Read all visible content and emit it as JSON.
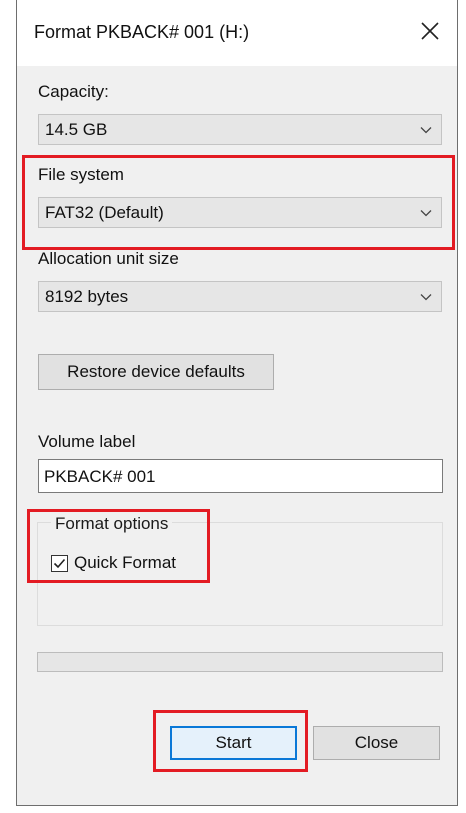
{
  "window": {
    "title": "Format PKBACK# 001 (H:)"
  },
  "capacity": {
    "label": "Capacity:",
    "value": "14.5 GB"
  },
  "file_system": {
    "label": "File system",
    "value": "FAT32 (Default)"
  },
  "allocation": {
    "label": "Allocation unit size",
    "value": "8192 bytes"
  },
  "restore_button": "Restore device defaults",
  "volume": {
    "label": "Volume label",
    "value": "PKBACK# 001"
  },
  "format_options": {
    "title": "Format options",
    "quick_format_label": "Quick Format",
    "quick_format_checked": true
  },
  "progress": {
    "fraction": 0
  },
  "buttons": {
    "start": "Start",
    "close": "Close"
  },
  "icons": {
    "close": "close-icon",
    "chevron": "chevron-down-icon",
    "check": "checkmark-icon"
  },
  "colors": {
    "highlight": "#e31b23",
    "focus": "#0a78d7",
    "progress": "#06b025"
  }
}
